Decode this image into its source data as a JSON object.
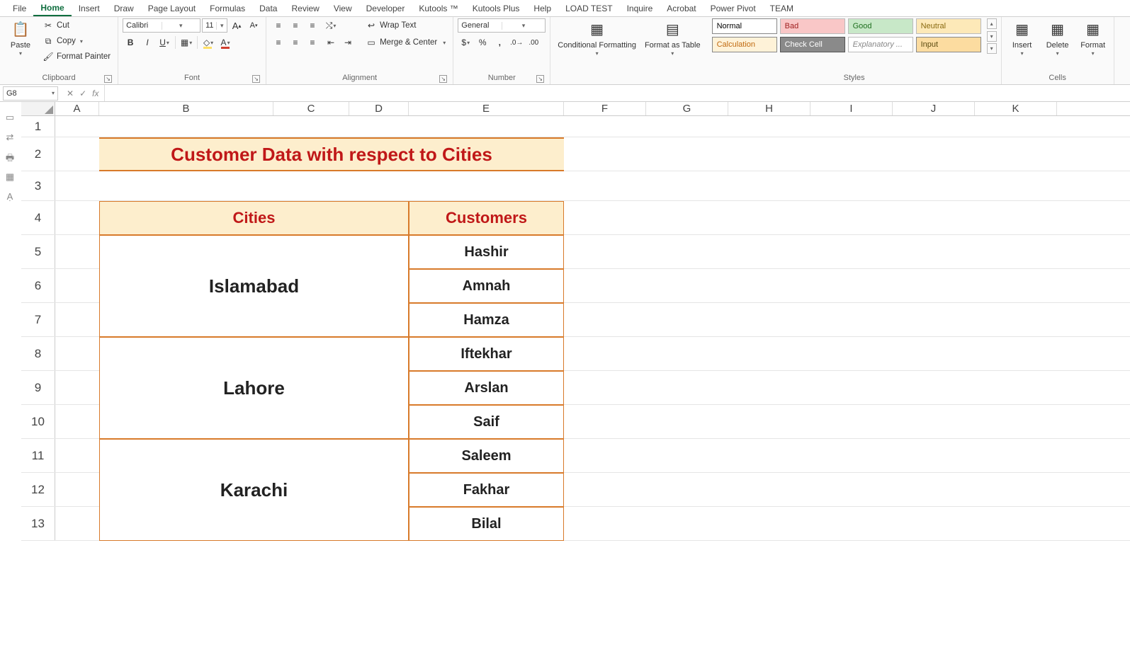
{
  "tabs": [
    "File",
    "Home",
    "Insert",
    "Draw",
    "Page Layout",
    "Formulas",
    "Data",
    "Review",
    "View",
    "Developer",
    "Kutools ™",
    "Kutools Plus",
    "Help",
    "LOAD TEST",
    "Inquire",
    "Acrobat",
    "Power Pivot",
    "TEAM"
  ],
  "activeTab": "Home",
  "clipboard": {
    "paste": "Paste",
    "cut": "Cut",
    "copy": "Copy",
    "fmtPainter": "Format Painter",
    "label": "Clipboard"
  },
  "font": {
    "name": "Calibri",
    "size": "11",
    "label": "Font"
  },
  "alignment": {
    "wrap": "Wrap Text",
    "merge": "Merge & Center",
    "label": "Alignment"
  },
  "number": {
    "fmt": "General",
    "label": "Number"
  },
  "cond": {
    "cf": "Conditional Formatting",
    "ft": "Format as Table"
  },
  "styles": {
    "cells": [
      {
        "t": "Normal",
        "bg": "#ffffff",
        "fg": "#000000",
        "bd": "#888"
      },
      {
        "t": "Bad",
        "bg": "#f9c7c7",
        "fg": "#a02020"
      },
      {
        "t": "Good",
        "bg": "#c8e8c8",
        "fg": "#1f6f1f"
      },
      {
        "t": "Neutral",
        "bg": "#fde9b8",
        "fg": "#8a6a10"
      },
      {
        "t": "Calculation",
        "bg": "#fef2d8",
        "fg": "#c06a10",
        "bd": "#888"
      },
      {
        "t": "Check Cell",
        "bg": "#8a8a8a",
        "fg": "#ffffff",
        "bd": "#555"
      },
      {
        "t": "Explanatory ...",
        "bg": "#ffffff",
        "fg": "#888",
        "it": true
      },
      {
        "t": "Input",
        "bg": "#fcdca0",
        "fg": "#5a4a10",
        "bd": "#888"
      }
    ],
    "label": "Styles"
  },
  "cells": {
    "insert": "Insert",
    "delete": "Delete",
    "format": "Format",
    "label": "Cells"
  },
  "namebox": "G8",
  "columns": [
    "A",
    "B",
    "C",
    "D",
    "E",
    "F",
    "G",
    "H",
    "I",
    "J",
    "K"
  ],
  "rowNums": [
    1,
    2,
    3,
    4,
    5,
    6,
    7,
    8,
    9,
    10,
    11,
    12,
    13
  ],
  "sheet": {
    "title": "Customer Data with respect to Cities",
    "h1": "Cities",
    "h2": "Customers",
    "data": [
      {
        "city": "Islamabad",
        "cust": [
          "Hashir",
          "Amnah",
          "Hamza"
        ]
      },
      {
        "city": "Lahore",
        "cust": [
          "Iftekhar",
          "Arslan",
          "Saif"
        ]
      },
      {
        "city": "Karachi",
        "cust": [
          "Saleem",
          "Fakhar",
          "Bilal"
        ]
      }
    ]
  }
}
